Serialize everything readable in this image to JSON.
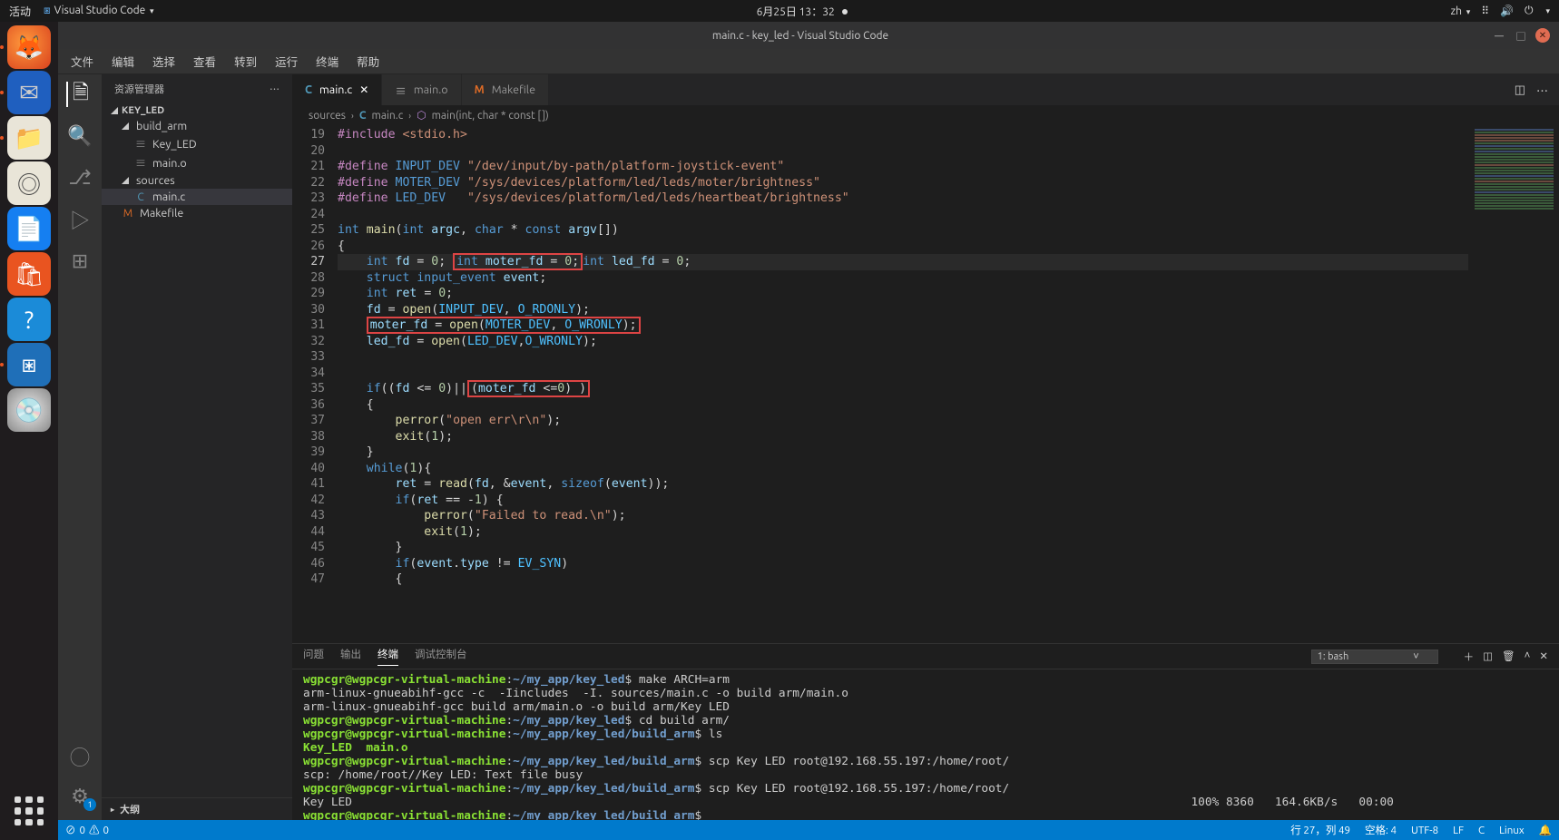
{
  "gnome": {
    "activities": "活动",
    "app_name": "Visual Studio Code",
    "clock": "6月25日 13：32",
    "lang": "zh"
  },
  "vscode": {
    "title": "main.c - key_led - Visual Studio Code",
    "menu": [
      "文件",
      "编辑",
      "选择",
      "查看",
      "转到",
      "运行",
      "终端",
      "帮助"
    ],
    "explorer": {
      "title": "资源管理器",
      "workspace": "KEY_LED",
      "tree": {
        "build_arm": "build_arm",
        "key_led_bin": "Key_LED",
        "main_o": "main.o",
        "sources": "sources",
        "main_c": "main.c",
        "makefile": "Makefile"
      },
      "outline": "大纲"
    },
    "tabs": [
      {
        "icon": "C",
        "iconColor": "#519aba",
        "label": "main.c",
        "active": true
      },
      {
        "icon": "≡",
        "iconColor": "#888",
        "label": "main.o",
        "active": false
      },
      {
        "icon": "M",
        "iconColor": "#db6a26",
        "label": "Makefile",
        "active": false
      }
    ],
    "breadcrumbs": {
      "p0": "sources",
      "p1": "main.c",
      "p2": "main(int, char * const [])"
    },
    "code_lines": [
      {
        "n": 19,
        "h": "<span class='mac'>#include</span> <span class='str'>&lt;stdio.h&gt;</span>"
      },
      {
        "n": 20,
        "h": ""
      },
      {
        "n": 21,
        "h": "<span class='mac'>#define</span> <span class='def'>INPUT_DEV</span> <span class='str'>\"/dev/input/by-path/platform-joystick-event\"</span>"
      },
      {
        "n": 22,
        "h": "<span class='mac'>#define</span> <span class='def'>MOTER_DEV</span> <span class='str'>\"/sys/devices/platform/led/leds/moter/brightness\"</span>"
      },
      {
        "n": 23,
        "h": "<span class='mac'>#define</span> <span class='def'>LED_DEV</span>   <span class='str'>\"/sys/devices/platform/led/leds/heartbeat/brightness\"</span>"
      },
      {
        "n": 24,
        "h": ""
      },
      {
        "n": 25,
        "h": "<span class='type'>int</span> <span class='fn'>main</span>(<span class='type'>int</span> <span class='var'>argc</span>, <span class='type'>char</span> * <span class='type'>const</span> <span class='var'>argv</span>[])"
      },
      {
        "n": 26,
        "h": "{"
      },
      {
        "n": 27,
        "h": "    <span class='type'>int</span> <span class='var'>fd</span> = <span class='num'>0</span>; <span class='redbox'><span class='type'>int</span> <span class='var'>moter_fd</span> = <span class='num'>0</span>;</span><span class='type'>int</span> <span class='var'>led_fd</span> = <span class='num'>0</span>;",
        "current": true
      },
      {
        "n": 28,
        "h": "    <span class='type'>struct</span> <span class='type'>input_event</span> <span class='var'>event</span>;"
      },
      {
        "n": 29,
        "h": "    <span class='type'>int</span> <span class='var'>ret</span> = <span class='num'>0</span>;"
      },
      {
        "n": 30,
        "h": "    <span class='var'>fd</span> = <span class='fn'>open</span>(<span class='const'>INPUT_DEV</span>, <span class='const'>O_RDONLY</span>);"
      },
      {
        "n": 31,
        "h": "    <span class='redbox'><span class='var'>moter_fd</span> = <span class='fn'>open</span>(<span class='const'>MOTER_DEV</span>, <span class='const'>O_WRONLY</span>);</span>"
      },
      {
        "n": 32,
        "h": "    <span class='var'>led_fd</span> = <span class='fn'>open</span>(<span class='const'>LED_DEV</span>,<span class='const'>O_WRONLY</span>);"
      },
      {
        "n": 33,
        "h": ""
      },
      {
        "n": 34,
        "h": ""
      },
      {
        "n": 35,
        "h": "    <span class='kw'>if</span>((<span class='var'>fd</span> &lt;= <span class='num'>0</span>)||<span class='redbox'>(<span class='var'>moter_fd</span> &lt;=<span class='num'>0</span>) )</span>"
      },
      {
        "n": 36,
        "h": "    {"
      },
      {
        "n": 37,
        "h": "        <span class='fn'>perror</span>(<span class='str'>\"open err\\r\\n\"</span>);"
      },
      {
        "n": 38,
        "h": "        <span class='fn'>exit</span>(<span class='num'>1</span>);"
      },
      {
        "n": 39,
        "h": "    }"
      },
      {
        "n": 40,
        "h": "    <span class='kw'>while</span>(<span class='num'>1</span>){"
      },
      {
        "n": 41,
        "h": "        <span class='var'>ret</span> = <span class='fn'>read</span>(<span class='var'>fd</span>, &amp;<span class='var'>event</span>, <span class='kw'>sizeof</span>(<span class='var'>event</span>));"
      },
      {
        "n": 42,
        "h": "        <span class='kw'>if</span>(<span class='var'>ret</span> == -<span class='num'>1</span>) {"
      },
      {
        "n": 43,
        "h": "            <span class='fn'>perror</span>(<span class='str'>\"Failed to read.\\n\"</span>);"
      },
      {
        "n": 44,
        "h": "            <span class='fn'>exit</span>(<span class='num'>1</span>);"
      },
      {
        "n": 45,
        "h": "        }"
      },
      {
        "n": 46,
        "h": "        <span class='kw'>if</span>(<span class='var'>event</span>.<span class='var'>type</span> != <span class='const'>EV_SYN</span>)"
      },
      {
        "n": 47,
        "h": "        {"
      }
    ],
    "panel": {
      "tabs": {
        "problems": "问题",
        "output": "输出",
        "terminal": "终端",
        "debug": "调试控制台"
      },
      "term_select": "1: bash",
      "terminal_lines": [
        {
          "userhost": "wgpcgr@wgpcgr-virtual-machine",
          "path": "~/my_app/key_led",
          "cmd": "make ARCH=arm"
        },
        {
          "plain": "arm-linux-gnueabihf-gcc -c  -Iincludes  -I. sources/main.c -o build arm/main.o"
        },
        {
          "plain": "arm-linux-gnueabihf-gcc build arm/main.o -o build arm/Key LED"
        },
        {
          "userhost": "wgpcgr@wgpcgr-virtual-machine",
          "path": "~/my_app/key_led",
          "cmd": "cd build arm/"
        },
        {
          "userhost": "wgpcgr@wgpcgr-virtual-machine",
          "path": "~/my_app/key_led/build_arm",
          "cmd": "ls"
        },
        {
          "green": "Key_LED  main.o"
        },
        {
          "userhost": "wgpcgr@wgpcgr-virtual-machine",
          "path": "~/my_app/key_led/build_arm",
          "cmd": "scp Key LED root@192.168.55.197:/home/root/"
        },
        {
          "plain": "scp: /home/root//Key LED: Text file busy"
        },
        {
          "userhost": "wgpcgr@wgpcgr-virtual-machine",
          "path": "~/my_app/key_led/build_arm",
          "cmd": "scp Key LED root@192.168.55.197:/home/root/"
        },
        {
          "plain": "Key LED                                                                                                                        100% 8360   164.6KB/s   00:00"
        },
        {
          "userhost": "wgpcgr@wgpcgr-virtual-machine",
          "path": "~/my_app/key_led/build_arm",
          "cmd": ""
        }
      ]
    },
    "status": {
      "errors": "0",
      "warnings": "0",
      "line_col": "行 27，列 49",
      "spaces": "空格: 4",
      "encoding": "UTF-8",
      "eol": "LF",
      "lang": "C",
      "os": "Linux"
    }
  }
}
